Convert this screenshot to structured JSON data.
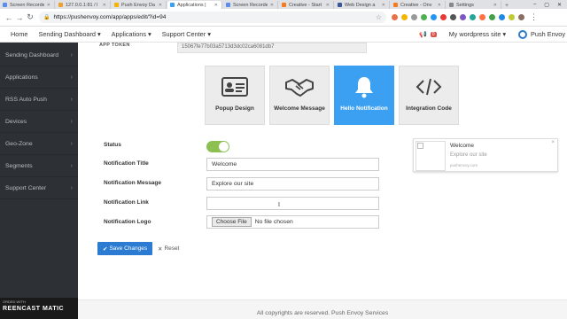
{
  "browser": {
    "tabs": [
      {
        "title": "Screen Recorder",
        "color": "#5b8def"
      },
      {
        "title": "127.0.0.1:81 / l",
        "color": "#f0a030"
      },
      {
        "title": "Push Envoy Da",
        "color": "#f4b400"
      },
      {
        "title": "Applications |",
        "color": "#3b9ff2",
        "active": true
      },
      {
        "title": "Screen Recorder",
        "color": "#5b8def"
      },
      {
        "title": "Creative - Start",
        "color": "#f47b20"
      },
      {
        "title": "Web Design a",
        "color": "#3b5998"
      },
      {
        "title": "Creative - Onv",
        "color": "#f47b20"
      },
      {
        "title": "Settings",
        "color": "#888888"
      }
    ],
    "url": "https://pushenvoy.com/app/apps/edit/?id=94"
  },
  "topnav": {
    "home": "Home",
    "sending_dashboard": "Sending Dashboard",
    "applications": "Applications",
    "support_center": "Support Center",
    "notif_count": "0",
    "site_selector": "My wordpress site",
    "brand": "Push Envoy"
  },
  "sidebar": {
    "items": [
      {
        "label": "Sending Dashboard"
      },
      {
        "label": "Applications"
      },
      {
        "label": "RSS Auto Push"
      },
      {
        "label": "Devices"
      },
      {
        "label": "Geo-Zone"
      },
      {
        "label": "Segments"
      },
      {
        "label": "Support Center"
      }
    ]
  },
  "recorder": {
    "line1": "ORDED WITH",
    "line2": "REENCAST  MATIC"
  },
  "main": {
    "app_token_label": "APP TOKEN",
    "app_token_value": "15067fe77b03a5713d3dc02ca6081db7",
    "cards": [
      {
        "label": "Popup Design",
        "icon": "id-card-icon"
      },
      {
        "label": "Welcome Message",
        "icon": "handshake-icon"
      },
      {
        "label": "Hello Notification",
        "icon": "bell-icon",
        "active": true
      },
      {
        "label": "Integration Code",
        "icon": "code-icon"
      }
    ],
    "status_label": "Status",
    "title_label": "Notification Title",
    "title_value": "Welcome",
    "message_label": "Notification Message",
    "message_value": "Explore our site",
    "link_label": "Notification Link",
    "link_value": "",
    "logo_label": "Notification Logo",
    "file_button": "Choose File",
    "file_status": "No file chosen",
    "save_button": "Save Changes",
    "reset_button": "Reset"
  },
  "preview": {
    "title": "Welcome",
    "message": "Explore our site",
    "site": "pushenvoy.com",
    "close": "×"
  },
  "footer": {
    "text": "All copyrights are reserved. Push Envoy Services"
  },
  "colors": {
    "accent": "#3b9ff2",
    "primary_button": "#2a7bd1",
    "toggle_on": "#8cc152",
    "sidebar_bg": "#2d3035"
  }
}
